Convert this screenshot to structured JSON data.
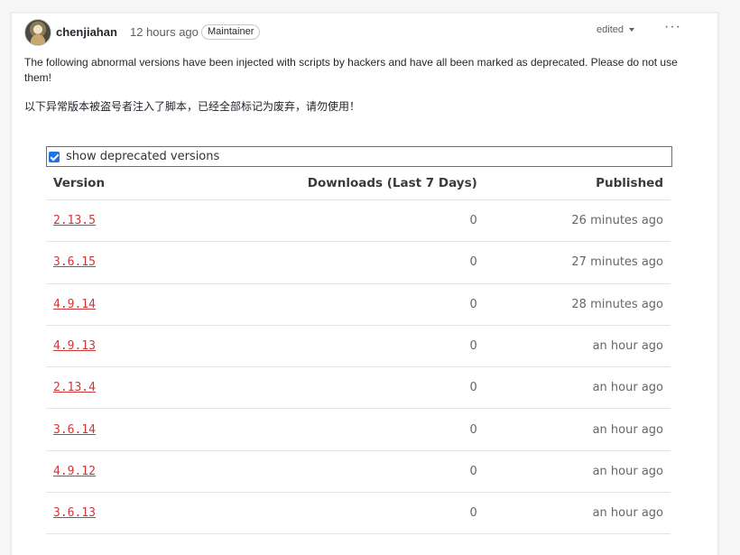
{
  "comment": {
    "author": "chenjiahan",
    "timestamp": "12 hours ago",
    "role_badge": "Maintainer",
    "edited_label": "edited",
    "more_menu": "···",
    "message_en": "The following abnormal versions have been injected with scripts by hackers and have all been marked as deprecated. Please do not use them!",
    "message_zh": "以下异常版本被盗号者注入了脚本，已经全部标记为废弃，请勿使用！"
  },
  "versions_panel": {
    "checkbox_label": "show deprecated versions",
    "checkbox_checked": true,
    "columns": [
      "Version",
      "Downloads (Last 7 Days)",
      "Published"
    ],
    "rows": [
      {
        "version": "2.13.5",
        "downloads": "0",
        "published": "26 minutes ago"
      },
      {
        "version": "3.6.15",
        "downloads": "0",
        "published": "27 minutes ago"
      },
      {
        "version": "4.9.14",
        "downloads": "0",
        "published": "28 minutes ago"
      },
      {
        "version": "4.9.13",
        "downloads": "0",
        "published": "an hour ago"
      },
      {
        "version": "2.13.4",
        "downloads": "0",
        "published": "an hour ago"
      },
      {
        "version": "3.6.14",
        "downloads": "0",
        "published": "an hour ago"
      },
      {
        "version": "4.9.12",
        "downloads": "0",
        "published": "an hour ago"
      },
      {
        "version": "3.6.13",
        "downloads": "0",
        "published": "an hour ago"
      }
    ]
  },
  "colors": {
    "version_link": "#cb3837",
    "checkbox_accent": "#1a73e8"
  }
}
